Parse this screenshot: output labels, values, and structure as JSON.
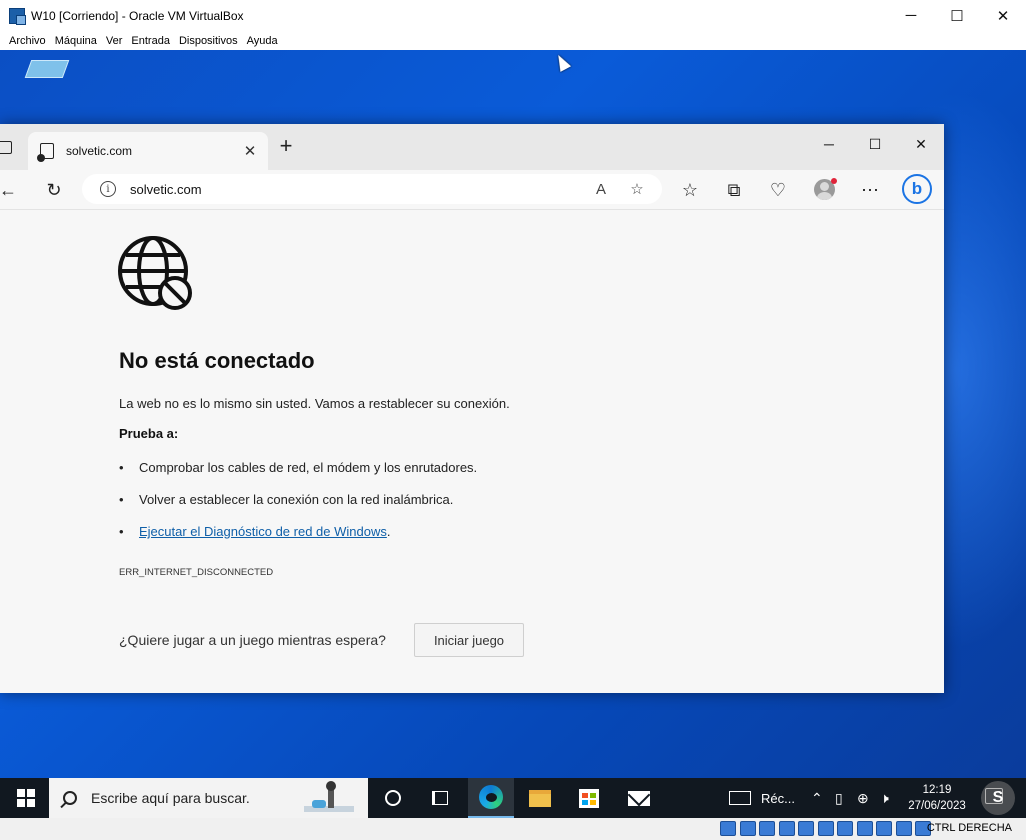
{
  "vbox": {
    "title": "W10 [Corriendo] - Oracle VM VirtualBox",
    "menu": [
      "Archivo",
      "Máquina",
      "Ver",
      "Entrada",
      "Dispositivos",
      "Ayuda"
    ],
    "host_key": "CTRL DERECHA"
  },
  "edge": {
    "tab_title": "solvetic.com",
    "address": "solvetic.com"
  },
  "error_page": {
    "title": "No está conectado",
    "description": "La web no es lo mismo sin usted. Vamos a restablecer su conexión.",
    "try_label": "Prueba a:",
    "suggestions": [
      "Comprobar los cables de red, el módem y los enrutadores.",
      "Volver a establecer la conexión con la red inalámbrica."
    ],
    "diagnostic_link": "Ejecutar el Diagnóstico de red de Windows",
    "diagnostic_suffix": ".",
    "error_code": "ERR_INTERNET_DISCONNECTED",
    "game_question": "¿Quiere jugar a un juego mientras espera?",
    "game_button": "Iniciar juego"
  },
  "taskbar": {
    "search_placeholder": "Escribe aquí para buscar.",
    "tray_app_label": "Réc...",
    "time": "12:19",
    "date": "27/06/2023"
  },
  "colors": {
    "link": "#0f5fa8",
    "desktop": "#0b4fc4",
    "taskbar": "#111820"
  }
}
